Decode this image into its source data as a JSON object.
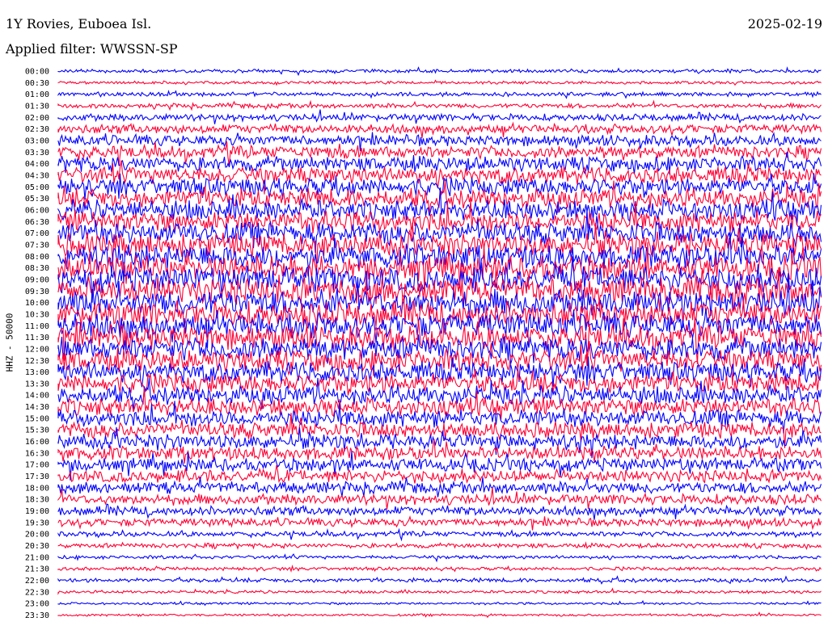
{
  "header": {
    "station": "1Y Rovies, Euboea Isl.",
    "date": "2025-02-19",
    "filter": "Applied filter: WWSSN-SP",
    "channel_label": "HHZ - 50000"
  },
  "colors": {
    "trace_a": "#0000ff",
    "trace_b": "#ff0033"
  },
  "chart_data": {
    "type": "line",
    "title": "1Y Rovies, Euboea Isl.",
    "subtitle": "Applied filter: WWSSN-SP",
    "ylabel": "HHZ - 50000",
    "xlabel": "",
    "grid": false,
    "rows": [
      "00:00",
      "00:30",
      "01:00",
      "01:30",
      "02:00",
      "02:30",
      "03:00",
      "03:30",
      "04:00",
      "04:30",
      "05:00",
      "05:30",
      "06:00",
      "06:30",
      "07:00",
      "07:30",
      "08:00",
      "08:30",
      "09:00",
      "09:30",
      "10:00",
      "10:30",
      "11:00",
      "11:30",
      "12:00",
      "12:30",
      "13:00",
      "13:30",
      "14:00",
      "14:30",
      "15:00",
      "15:30",
      "16:00",
      "16:30",
      "17:00",
      "17:30",
      "18:00",
      "18:30",
      "19:00",
      "19:30",
      "20:00",
      "20:30",
      "21:00",
      "21:30",
      "22:00",
      "22:30",
      "23:00",
      "23:30"
    ],
    "relative_amplitude": [
      0.6,
      0.5,
      0.7,
      0.8,
      1.2,
      1.6,
      1.9,
      2.2,
      2.6,
      2.9,
      3.1,
      3.3,
      3.5,
      3.6,
      3.8,
      4.0,
      4.2,
      4.3,
      4.4,
      4.5,
      4.5,
      4.4,
      4.3,
      4.2,
      4.0,
      3.8,
      3.6,
      3.4,
      3.2,
      3.0,
      2.9,
      2.7,
      2.6,
      2.4,
      2.3,
      2.1,
      2.0,
      1.8,
      1.6,
      1.4,
      0.9,
      0.8,
      0.6,
      0.6,
      0.7,
      0.5,
      0.4,
      0.4
    ]
  }
}
